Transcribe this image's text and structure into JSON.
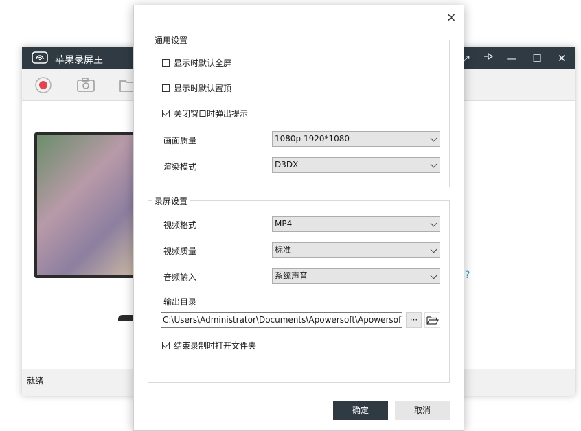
{
  "app": {
    "title": "苹果录屏王",
    "status": "就绪",
    "help_link": "?"
  },
  "dialog": {
    "general": {
      "title": "通用设置",
      "checks": [
        {
          "label": "显示时默认全屏",
          "checked": false
        },
        {
          "label": "显示时默认置顶",
          "checked": false
        },
        {
          "label": "关闭窗口时弹出提示",
          "checked": true
        }
      ],
      "quality_label": "画面质量",
      "quality_value": "1080p 1920*1080",
      "render_label": "渲染模式",
      "render_value": "D3DX"
    },
    "record": {
      "title": "录屏设置",
      "format_label": "视频格式",
      "format_value": "MP4",
      "vquality_label": "视频质量",
      "vquality_value": "标准",
      "audio_label": "音频输入",
      "audio_value": "系统声音",
      "output_label": "输出目录",
      "output_path": "C:\\Users\\Administrator\\Documents\\Apowersoft\\Apowersoft",
      "browse_dots": "···",
      "open_check": {
        "label": "结束录制时打开文件夹",
        "checked": true
      }
    },
    "ok": "确定",
    "cancel": "取消",
    "close": "×"
  },
  "colors": {
    "titlebar": "#2f3a43",
    "accent_link": "#2a9fd6",
    "record_red": "#e2434f"
  }
}
